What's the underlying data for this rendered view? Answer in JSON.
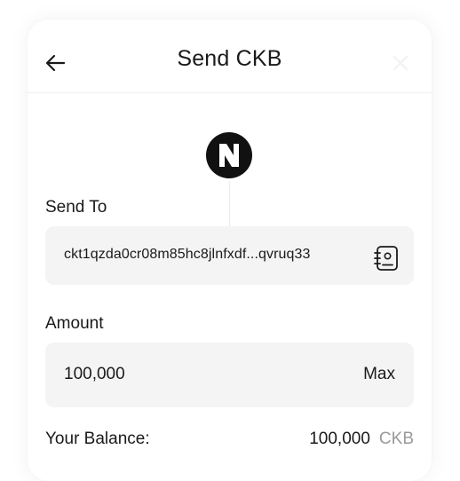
{
  "header": {
    "title": "Send CKB",
    "back_icon": "arrow-left-icon",
    "close_icon": "close-icon"
  },
  "logo": {
    "icon": "nervos-logo-icon"
  },
  "send_to": {
    "label": "Send To",
    "address": "ckt1qzda0cr08m85hc8jlnfxdf...qvruq33",
    "contacts_icon": "address-book-icon"
  },
  "amount": {
    "label": "Amount",
    "value": "100,000",
    "max_label": "Max"
  },
  "balance": {
    "label": "Your Balance:",
    "value": "100,000",
    "unit": "CKB"
  },
  "colors": {
    "field_background": "#f4f4f4",
    "muted_text": "#9a9a9a",
    "text": "#1a1a1a"
  }
}
